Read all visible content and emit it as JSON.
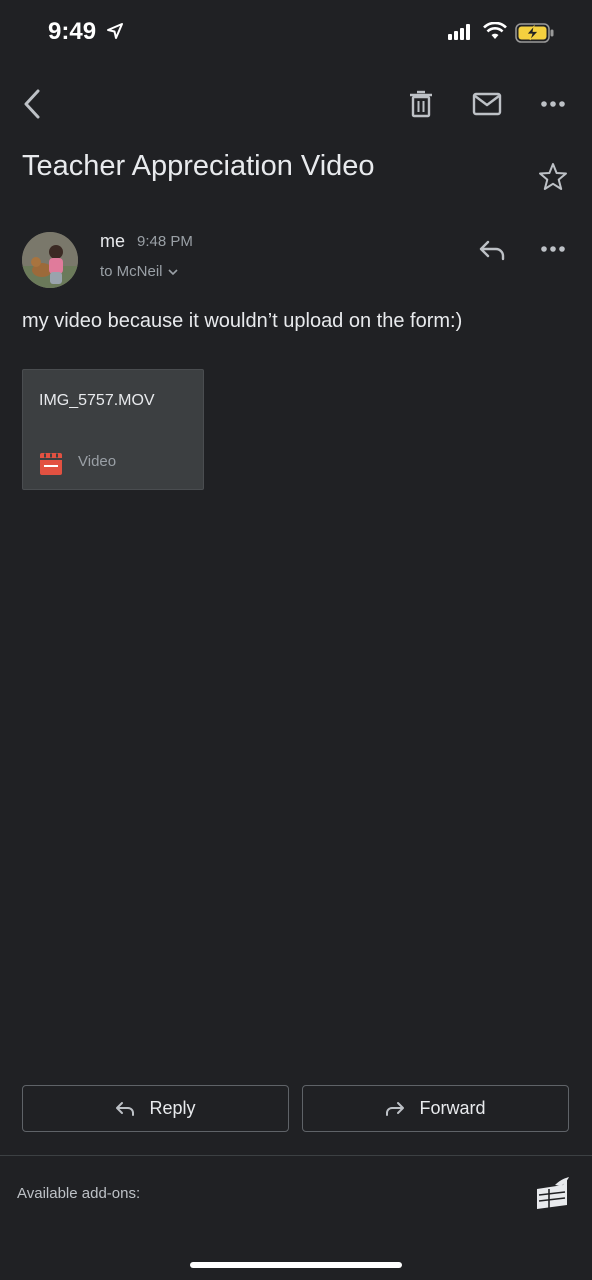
{
  "status_bar": {
    "time": "9:49",
    "icons": [
      "location-arrow-icon",
      "signal-icon",
      "wifi-icon",
      "battery-charging-icon"
    ],
    "battery_color": "#f4d03f"
  },
  "toolbar": {
    "icons": [
      "back-icon",
      "delete-icon",
      "mark-unread-icon",
      "more-icon"
    ]
  },
  "message": {
    "subject": "Teacher Appreciation Video",
    "sender": "me",
    "time": "9:48 PM",
    "recipient": "to McNeil",
    "body": "my video because it wouldn’t upload on the form:)"
  },
  "attachment": {
    "filename": "IMG_5757.MOV",
    "type": "Video",
    "icon": "video-clapper-icon",
    "icon_color": "#e25141"
  },
  "actions": {
    "reply_label": "Reply",
    "forward_label": "Forward"
  },
  "addons": {
    "label": "Available add-ons:"
  }
}
